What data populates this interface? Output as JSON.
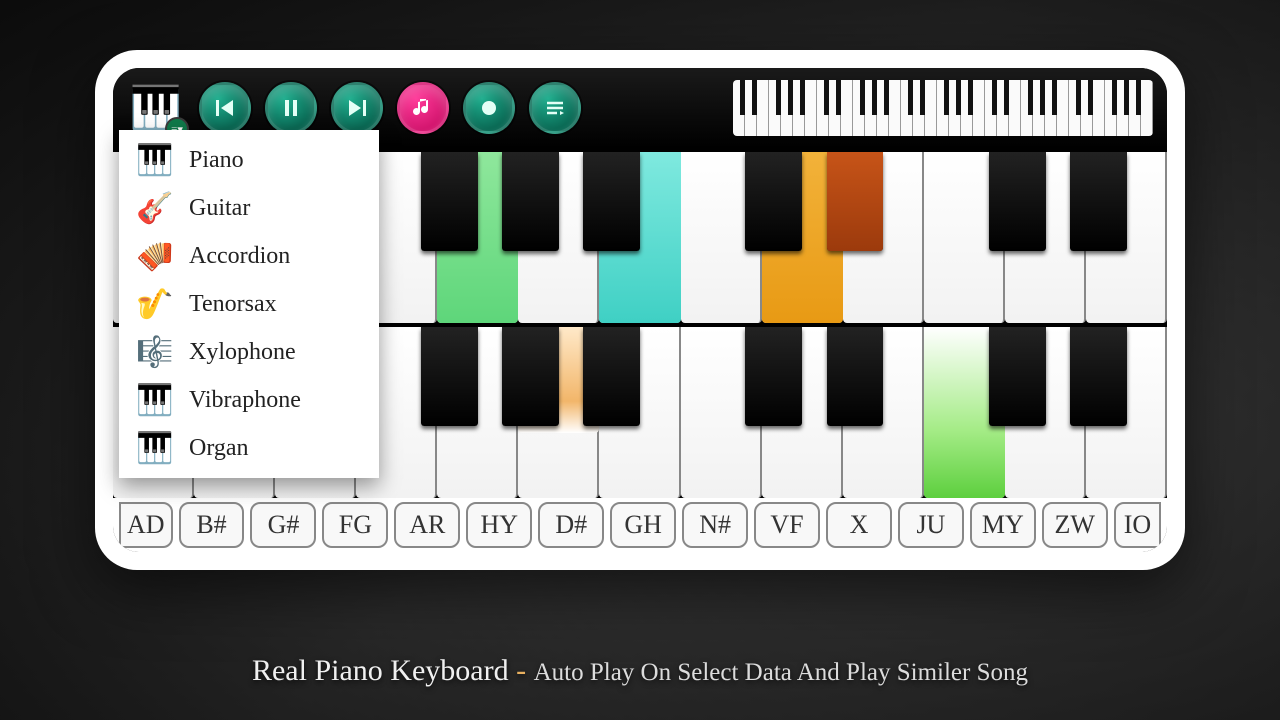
{
  "caption": {
    "title": "Real Piano Keyboard",
    "separator": "-",
    "subtitle": "Auto Play On Select Data And Play Similer Song"
  },
  "toolbar": {
    "current_instrument_icon": "piano",
    "buttons": [
      "previous",
      "pause",
      "next",
      "music",
      "record",
      "queue"
    ]
  },
  "instrument_menu": [
    {
      "icon": "grand-piano",
      "glyph": "🎹",
      "label": "Piano"
    },
    {
      "icon": "guitar",
      "glyph": "🎸",
      "label": "Guitar"
    },
    {
      "icon": "accordion",
      "glyph": "🪗",
      "label": "Accordion"
    },
    {
      "icon": "tenorsax",
      "glyph": "🎷",
      "label": "Tenorsax"
    },
    {
      "icon": "xylophone",
      "glyph": "🎼",
      "label": "Xylophone"
    },
    {
      "icon": "vibraphone",
      "glyph": "🎹",
      "label": "Vibraphone"
    },
    {
      "icon": "organ",
      "glyph": "🎹",
      "label": "Organ"
    }
  ],
  "chords": [
    "AD",
    "B#",
    "G#",
    "FG",
    "AR",
    "HY",
    "D#",
    "GH",
    "N#",
    "VF",
    "X",
    "JU",
    "MY",
    "ZW",
    "IO"
  ],
  "keyboard": {
    "rows": 2,
    "white_keys_per_row": 13,
    "black_key_positions_pct": [
      6.0,
      13.8,
      29.2,
      36.9,
      44.6,
      60.0,
      67.7,
      83.1,
      90.8
    ],
    "highlights_top": [
      {
        "type": "white",
        "index": 4,
        "color": "linear-gradient(#8fe79c,#5ed67a)"
      },
      {
        "type": "white",
        "index": 6,
        "color": "linear-gradient(#7fe9df,#3fd0c4)"
      },
      {
        "type": "white",
        "index": 8,
        "color": "linear-gradient(#f2b23a,#e89a14)"
      },
      {
        "type": "black",
        "left_pct": 67.7,
        "color": "linear-gradient(#c75418,#9c3a0c)"
      }
    ],
    "highlights_bottom": [
      {
        "type": "white",
        "index": 5,
        "color": "linear-gradient(#ffe9c9 0%, #f2b66a 70%, #fff 100%)",
        "partial": true
      },
      {
        "type": "white",
        "index": 10,
        "color": "linear-gradient(#fff 0%, #a5ec87 60%, #5dcf3e 100%)"
      }
    ]
  }
}
